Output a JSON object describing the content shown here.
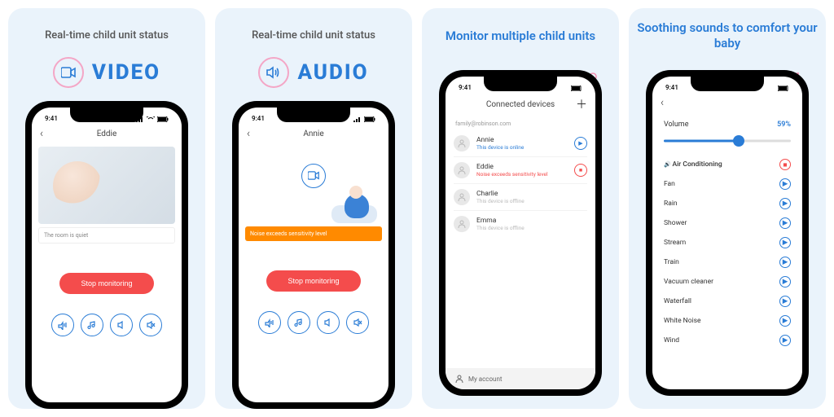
{
  "panel1": {
    "heading": "Real-time child unit status",
    "badge": "VIDEO",
    "phone": {
      "time": "9:41",
      "title": "Eddie",
      "status_text": "The room is quiet",
      "stop_label": "Stop monitoring"
    }
  },
  "panel2": {
    "heading": "Real-time child unit status",
    "badge": "AUDIO",
    "phone": {
      "time": "9:41",
      "title": "Annie",
      "status_text": "Noise exceeds sensitivity level",
      "stop_label": "Stop monitoring"
    }
  },
  "panel3": {
    "heading": "Monitor multiple child units",
    "phone": {
      "time": "9:41",
      "title": "Connected devices",
      "email": "family@robinson.com",
      "devices": [
        {
          "name": "Annie",
          "status": "This device is online",
          "kind": "online",
          "action": "play"
        },
        {
          "name": "Eddie",
          "status": "Noise exceeds sensitivity level",
          "kind": "alert",
          "action": "stop"
        },
        {
          "name": "Charlie",
          "status": "This device is offline",
          "kind": "offline",
          "action": ""
        },
        {
          "name": "Emma",
          "status": "This device is offline",
          "kind": "offline",
          "action": ""
        }
      ],
      "account_label": "My account"
    }
  },
  "panel4": {
    "heading": "Soothing sounds to comfort your baby",
    "phone": {
      "time": "9:41",
      "volume_label": "Volume",
      "volume_value": "59%",
      "volume_percent": 59,
      "sounds": [
        {
          "name": "Air Conditioning",
          "active": true,
          "state": "stop"
        },
        {
          "name": "Fan",
          "active": false,
          "state": "play"
        },
        {
          "name": "Rain",
          "active": false,
          "state": "play"
        },
        {
          "name": "Shower",
          "active": false,
          "state": "play"
        },
        {
          "name": "Stream",
          "active": false,
          "state": "play"
        },
        {
          "name": "Train",
          "active": false,
          "state": "play"
        },
        {
          "name": "Vacuum cleaner",
          "active": false,
          "state": "play"
        },
        {
          "name": "Waterfall",
          "active": false,
          "state": "play"
        },
        {
          "name": "White Noise",
          "active": false,
          "state": "play"
        },
        {
          "name": "Wind",
          "active": false,
          "state": "play"
        }
      ]
    }
  },
  "colors": {
    "accent": "#2a7cd6",
    "danger": "#f44c4c",
    "pink": "#f28fb1"
  }
}
